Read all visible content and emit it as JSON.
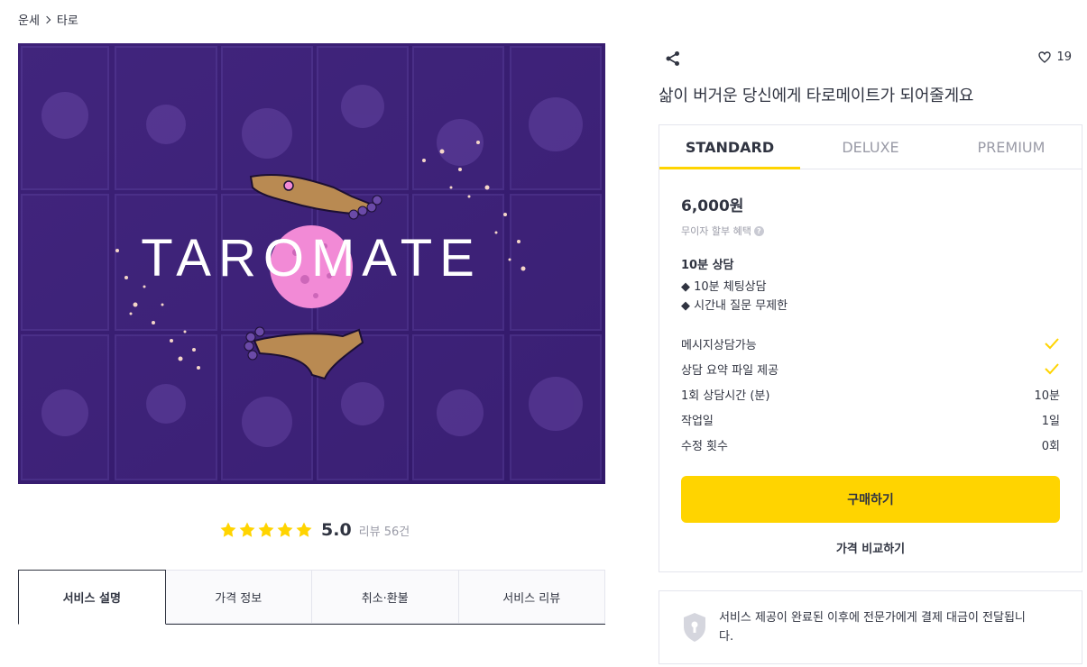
{
  "breadcrumb": {
    "category": "운세",
    "subcategory": "타로"
  },
  "hero": {
    "logo_text": "TAROMATE",
    "colors": {
      "background": "#3a1f74",
      "moon": "#f28ad6",
      "hand": "#b98a52"
    }
  },
  "rating": {
    "score": "5.0",
    "count": "리뷰 56건",
    "stars": 5,
    "star_color": "#ffd400"
  },
  "tabs": [
    {
      "label": "서비스 설명",
      "active": true
    },
    {
      "label": "가격 정보",
      "active": false
    },
    {
      "label": "취소·환불",
      "active": false
    },
    {
      "label": "서비스 리뷰",
      "active": false
    }
  ],
  "header": {
    "share_icon": "share-icon",
    "like_count": "19",
    "title": "삶이 버거운 당신에게 타로메이트가 되어줄게요"
  },
  "package": {
    "tabs": [
      {
        "label": "STANDARD",
        "active": true
      },
      {
        "label": "DELUXE",
        "active": false
      },
      {
        "label": "PREMIUM",
        "active": false
      }
    ],
    "price": "6,000원",
    "installment": "무이자 할부 혜택",
    "plan_name": "10분 상담",
    "plan_lines": [
      "◆ 10분 체팅상담",
      "◆ 시간내 질문 무제한"
    ],
    "features": [
      {
        "label": "메시지상담가능",
        "value": "",
        "check": true
      },
      {
        "label": "상담 요약 파일 제공",
        "value": "",
        "check": true
      },
      {
        "label": "1회 상담시간 (분)",
        "value": "10분",
        "check": false
      },
      {
        "label": "작업일",
        "value": "1일",
        "check": false
      },
      {
        "label": "수정 횟수",
        "value": "0회",
        "check": false
      }
    ],
    "buy_label": "구매하기",
    "compare_label": "가격 비교하기",
    "accent": "#ffd400"
  },
  "notice": {
    "text": "서비스 제공이 완료된 이후에 전문가에게 결제 대금이 전달됩니다."
  }
}
